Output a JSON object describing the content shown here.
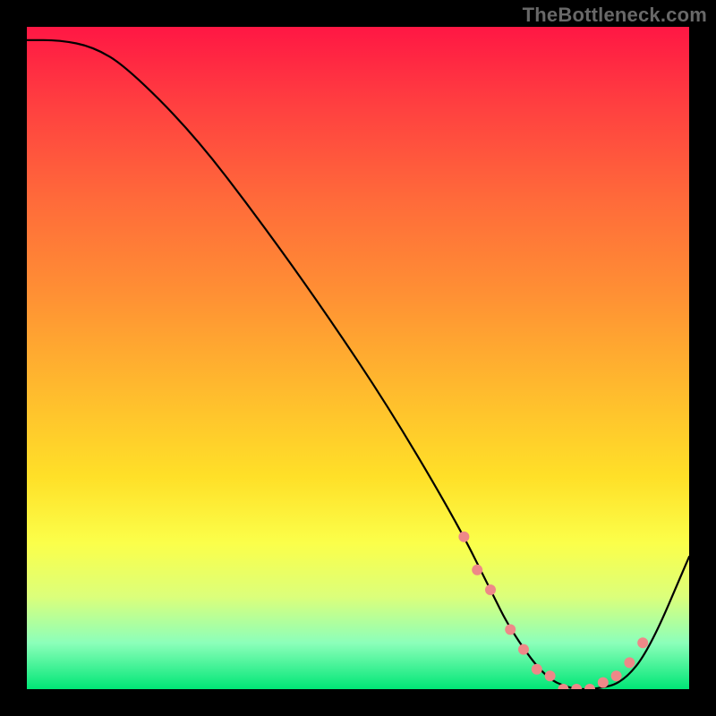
{
  "watermark": "TheBottleneck.com",
  "chart_data": {
    "type": "line",
    "title": "",
    "xlabel": "",
    "ylabel": "",
    "xlim": [
      0,
      100
    ],
    "ylim": [
      0,
      100
    ],
    "series": [
      {
        "name": "curve",
        "x": [
          0,
          5,
          10,
          15,
          25,
          35,
          45,
          55,
          65,
          70,
          73,
          78,
          82,
          86,
          90,
          94,
          100
        ],
        "values": [
          98,
          98,
          97,
          94,
          84,
          71,
          57,
          42,
          25,
          15,
          9,
          2,
          0,
          0,
          1,
          6,
          20
        ]
      }
    ],
    "highlight_points": {
      "name": "pink-dots",
      "color": "#e88",
      "x": [
        66,
        68,
        70,
        73,
        75,
        77,
        79,
        81,
        83,
        85,
        87,
        89,
        91,
        93
      ],
      "values": [
        23,
        18,
        15,
        9,
        6,
        3,
        2,
        0,
        0,
        0,
        1,
        2,
        4,
        7
      ]
    }
  }
}
